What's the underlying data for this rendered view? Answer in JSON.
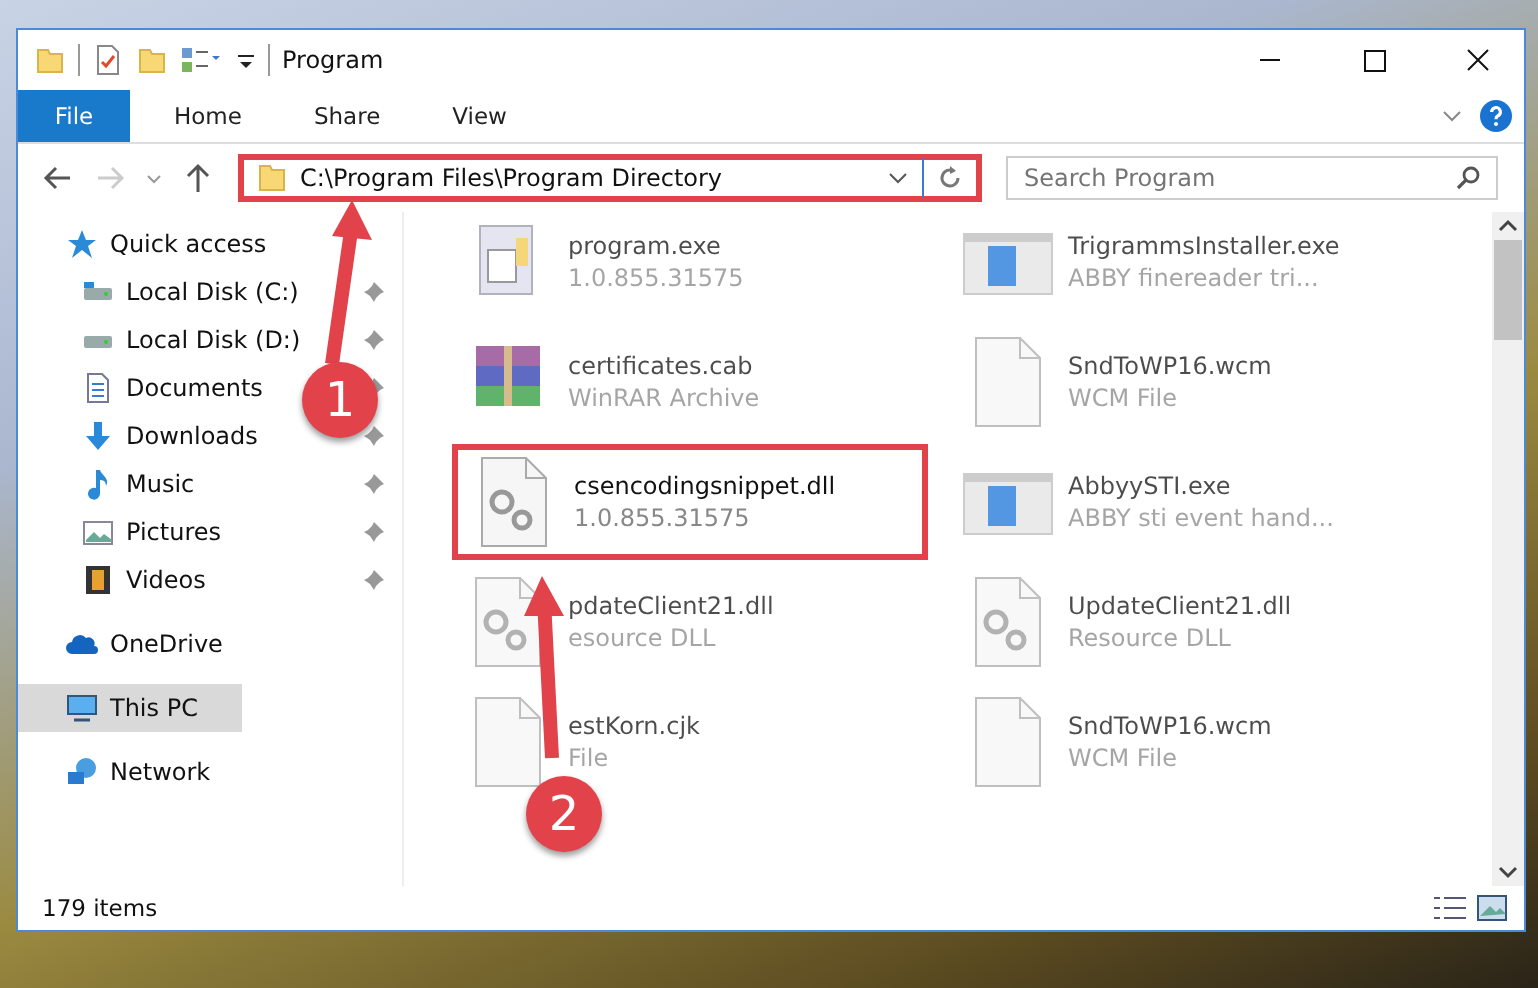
{
  "window": {
    "title": "Program"
  },
  "ribbon_tabs": [
    {
      "label": "File",
      "selected": true
    },
    {
      "label": "Home",
      "selected": false
    },
    {
      "label": "Share",
      "selected": false
    },
    {
      "label": "View",
      "selected": false
    }
  ],
  "navigation": {
    "back_disabled": false,
    "forward_disabled": true
  },
  "address_bar": {
    "value": "C:\\Program Files\\Program Directory",
    "highlighted": true
  },
  "search": {
    "placeholder": "Search Program"
  },
  "sidebar": {
    "items": [
      {
        "label": "Quick access",
        "kind": "star",
        "selected": false,
        "children": [
          {
            "label": "Local Disk (C:)",
            "kind": "drive-c",
            "pinned": true,
            "selected": false
          },
          {
            "label": "Local Disk (D:)",
            "kind": "drive",
            "pinned": true,
            "selected": false
          },
          {
            "label": "Documents",
            "kind": "documents",
            "pinned": true,
            "selected": false
          },
          {
            "label": "Downloads",
            "kind": "downloads",
            "pinned": true,
            "selected": false
          },
          {
            "label": "Music",
            "kind": "music",
            "pinned": true,
            "selected": false
          },
          {
            "label": "Pictures",
            "kind": "pictures",
            "pinned": true,
            "selected": false
          },
          {
            "label": "Videos",
            "kind": "videos",
            "pinned": true,
            "selected": false
          }
        ]
      },
      {
        "label": "OneDrive",
        "kind": "cloud",
        "selected": false
      },
      {
        "label": "This PC",
        "kind": "pc",
        "selected": true
      },
      {
        "label": "Network",
        "kind": "network",
        "selected": false
      }
    ]
  },
  "files": [
    {
      "name": "program.exe",
      "detail": "1.0.855.31575",
      "kind": "installer",
      "blurred": true,
      "highlighted": false
    },
    {
      "name": "TrigrammsInstaller.exe",
      "detail": "ABBY finereader tri...",
      "kind": "app",
      "blurred": true,
      "highlighted": false
    },
    {
      "name": "certificates.cab",
      "detail": "WinRAR Archive",
      "kind": "archive",
      "blurred": true,
      "highlighted": false
    },
    {
      "name": "SndToWP16.wcm",
      "detail": "WCM File",
      "kind": "blank",
      "blurred": true,
      "highlighted": false
    },
    {
      "name": "csencodingsnippet.dll",
      "detail": "1.0.855.31575",
      "kind": "dll",
      "blurred": false,
      "highlighted": true
    },
    {
      "name": "AbbyySTI.exe",
      "detail": "ABBY sti event hand...",
      "kind": "app",
      "blurred": true,
      "highlighted": false
    },
    {
      "name": "pdateClient21.dll",
      "detail": "esource DLL",
      "kind": "dll",
      "blurred": true,
      "highlighted": false
    },
    {
      "name": "UpdateClient21.dll",
      "detail": "Resource DLL",
      "kind": "dll",
      "blurred": true,
      "highlighted": false
    },
    {
      "name": "estKorn.cjk",
      "detail": "File",
      "kind": "blank",
      "blurred": true,
      "highlighted": false
    },
    {
      "name": "SndToWP16.wcm",
      "detail": "WCM File",
      "kind": "blank",
      "blurred": true,
      "highlighted": false
    }
  ],
  "annotations": [
    {
      "label": "1"
    },
    {
      "label": "2"
    }
  ],
  "status_bar": {
    "item_count": "179 items"
  }
}
